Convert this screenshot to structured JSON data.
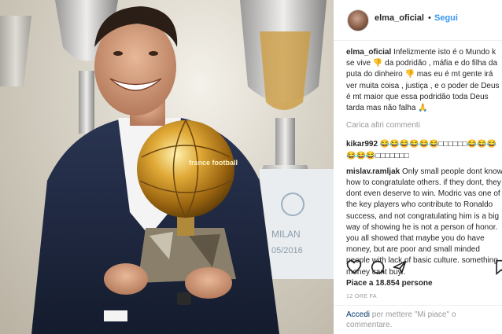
{
  "header": {
    "username": "elma_oficial",
    "separator": "•",
    "follow_label": "Segui"
  },
  "caption": {
    "user": "elma_oficial",
    "text": "Infelizmente isto é o Mundo k se vive 👎 da podridão , máfia e do filha da puta do dinheiro 👎 mas eu é mt gente irá ver muita coisa , justiça , e o poder de Deus é mt maior que essa podridão toda Deus tarda mas não falha 🙏"
  },
  "load_more": "Carica altri commenti",
  "comments": [
    {
      "user": "kikar992",
      "text": "😂😂😂😂😂😂□□□□□□😂😂😂😂😂😂□□□□□□□"
    },
    {
      "user": "mislav.ramljak",
      "text": "Only small people dont know how to congratulate others. if they dont, they dont even deserve to win. Modric vas one of the key players who contribute to Ronaldo success, and not congratulating him is a big way of showing he is not a person of honor. you all showed that maybe you do have money, but are poor and small minded people with lack of basic culture. something money cant buy.."
    }
  ],
  "likes_text": "Piace a 18.854 persone",
  "time_text": "12 ORE FA",
  "login_prompt": {
    "link": "Accedi",
    "rest": " per mettere \"Mi piace\" o commentare."
  },
  "photo": {
    "trophy_text": "france football",
    "banner_text_1": "MILAN",
    "banner_text_2": "05/2016"
  },
  "colors": {
    "link_blue": "#3897f0",
    "text_dark": "#262626",
    "text_grey": "#999999",
    "login_link": "#003569"
  },
  "icons": [
    "heart-icon",
    "comment-icon",
    "share-icon",
    "bookmark-icon"
  ]
}
